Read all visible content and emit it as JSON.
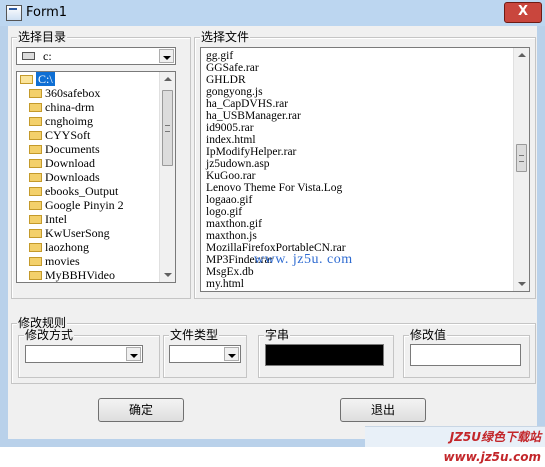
{
  "window": {
    "title": "Form1",
    "close_label": "X"
  },
  "folder_group": {
    "label": "选择目录",
    "drive": "c:",
    "directories": [
      {
        "name": "C:\\",
        "open": true,
        "selected": true
      },
      {
        "name": "360safebox"
      },
      {
        "name": "china-drm"
      },
      {
        "name": "cnghoimg"
      },
      {
        "name": "CYYSoft"
      },
      {
        "name": "Documents"
      },
      {
        "name": "Download"
      },
      {
        "name": "Downloads"
      },
      {
        "name": "ebooks_Output"
      },
      {
        "name": "Google Pinyin 2"
      },
      {
        "name": "Intel"
      },
      {
        "name": "KwUserSong"
      },
      {
        "name": "laozhong"
      },
      {
        "name": "movies"
      },
      {
        "name": "MyBBHVideo"
      }
    ]
  },
  "file_group": {
    "label": "选择文件",
    "files": [
      "gg.gif",
      "GGSafe.rar",
      "GHLDR",
      "gongyong.js",
      "ha_CapDVHS.rar",
      "ha_USBManager.rar",
      "id9005.rar",
      "index.html",
      "IpModifyHelper.rar",
      "jz5udown.asp",
      "KuGoo.rar",
      "Lenovo Theme For Vista.Log",
      "logaao.gif",
      "logo.gif",
      "maxthon.gif",
      "maxthon.js",
      "MozillaFirefoxPortableCN.rar",
      "MP3Finder.rar",
      "MsgEx.db",
      "my.html"
    ]
  },
  "watermark": "www. jz5u. com",
  "rules_group": {
    "label": "修改规则",
    "method_label": "修改方式",
    "filetype_label": "文件类型",
    "string_label": "字串",
    "value_label": "修改值"
  },
  "buttons": {
    "ok": "确定",
    "exit": "退出"
  },
  "site_badge": "JZ5U绿色下载站www.jz5u.com"
}
